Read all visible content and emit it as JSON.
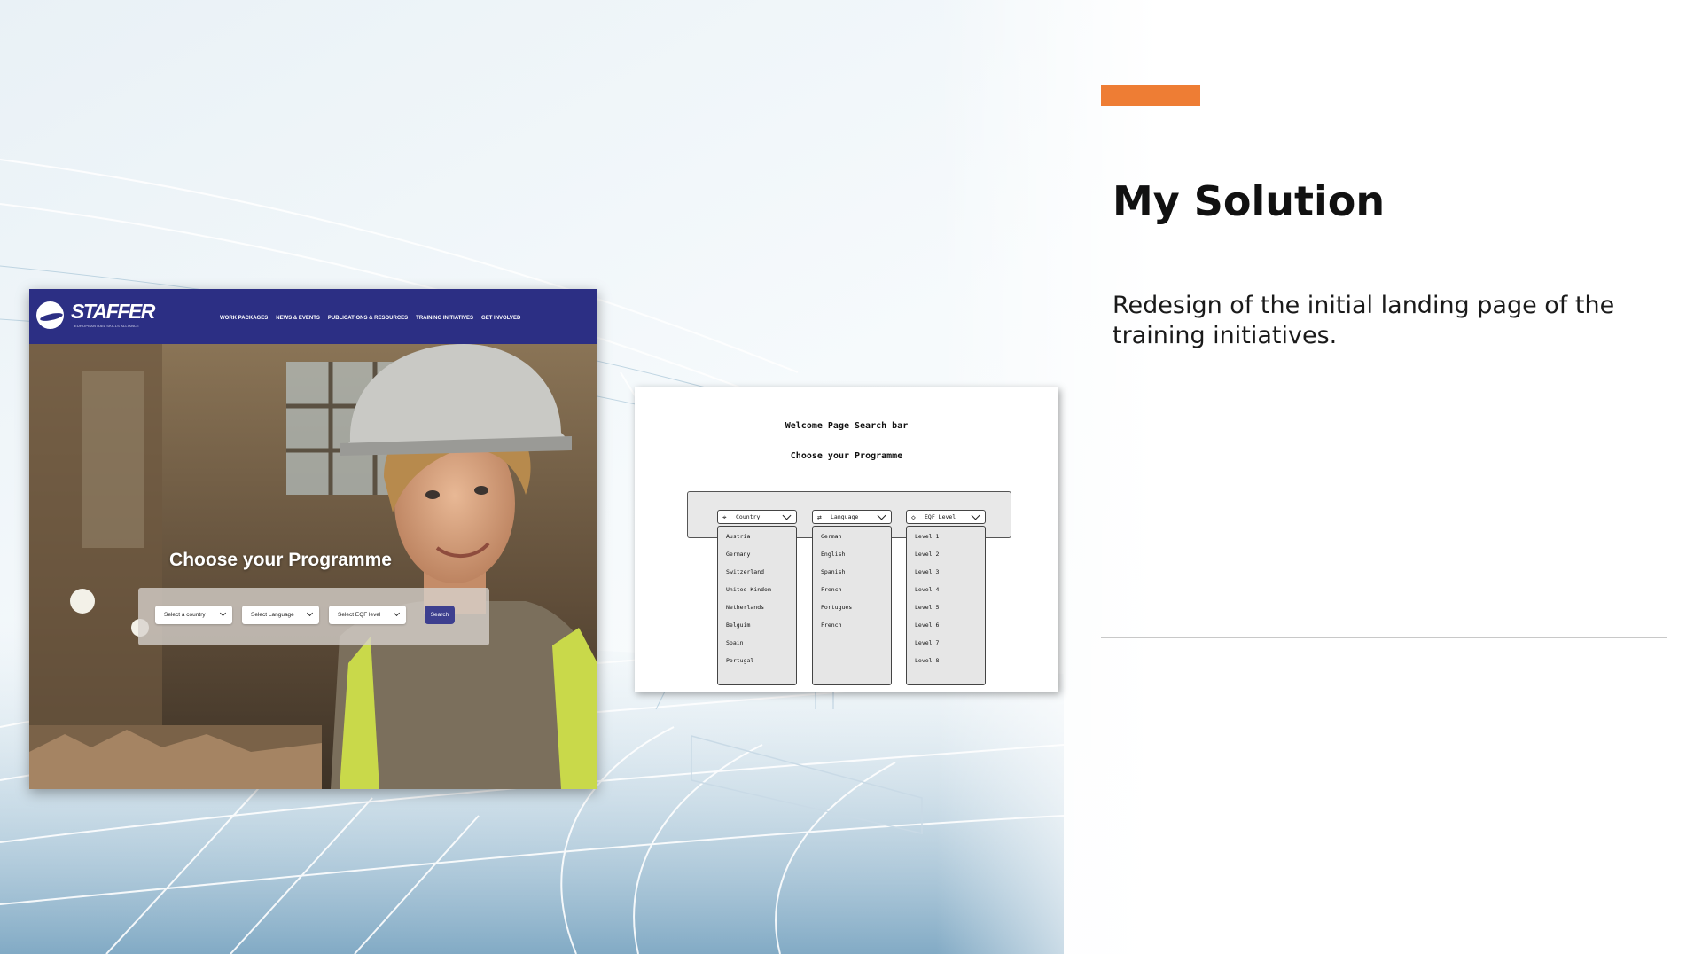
{
  "slide": {
    "heading": "My Solution",
    "description": "Redesign of the initial landing page of the training initiatives.",
    "accent_color": "#ee7d34"
  },
  "mockup": {
    "logo_text": "STAFFER",
    "logo_tagline": "EUROPEAN RAIL SKILLS ALLIANCE",
    "nav_items": [
      "WORK PACKAGES",
      "NEWS & EVENTS",
      "PUBLICATIONS & RESOURCES",
      "TRAINING INITIATIVES",
      "GET INVOLVED"
    ],
    "hero_title": "Choose your Programme",
    "selects": [
      "Select a country",
      "Select Language",
      "Select EQF level"
    ],
    "search_label": "Search",
    "brand_color": "#2c2f84"
  },
  "wireframe": {
    "title": "Welcome Page Search bar",
    "subtitle": "Choose your Programme",
    "dropdowns": [
      {
        "label": "Country",
        "icon": "location-pin-icon",
        "options": [
          "Austria",
          "Germany",
          "Switzerland",
          "United Kindom",
          "Netherlands",
          "Belguim",
          "Spain",
          "Portugal"
        ]
      },
      {
        "label": "Language",
        "icon": "translate-icon",
        "options": [
          "German",
          "English",
          "Spanish",
          "French",
          "Portugues",
          "French"
        ]
      },
      {
        "label": "EQF Level",
        "icon": "graduation-cap-icon",
        "options": [
          "Level 1",
          "Level 2",
          "Level 3",
          "Level 4",
          "Level 5",
          "Level 6",
          "Level 7",
          "Level 8"
        ]
      }
    ]
  }
}
